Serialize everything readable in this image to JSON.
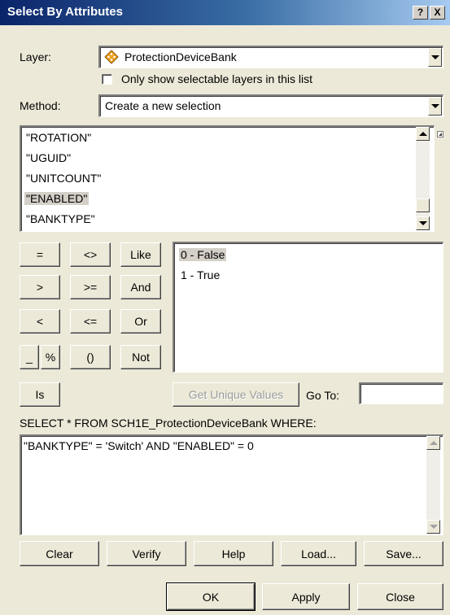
{
  "window": {
    "title": "Select By Attributes",
    "help_label": "?",
    "close_label": "X"
  },
  "layer": {
    "label": "Layer:",
    "value": "ProtectionDeviceBank",
    "icon": "layer-diamond-icon",
    "checkbox_label": "Only show selectable layers in this list",
    "checkbox_checked": false
  },
  "method": {
    "label": "Method:",
    "value": "Create a new selection"
  },
  "fields": {
    "items": [
      "\"ROTATION\"",
      "\"UGUID\"",
      "\"UNITCOUNT\"",
      "\"ENABLED\"",
      "\"BANKTYPE\""
    ],
    "selected_index": 3
  },
  "operators": {
    "row1": [
      "=",
      "<>",
      "Like"
    ],
    "row2": [
      ">",
      ">=",
      "And"
    ],
    "row3": [
      "<",
      "<=",
      "Or"
    ],
    "row4": [
      "_",
      "%",
      "()",
      "Not"
    ],
    "is_label": "Is"
  },
  "values": {
    "items": [
      "0 - False",
      "1 - True"
    ],
    "selected_index": 0,
    "unique_button": "Get Unique Values",
    "goto_label": "Go To:",
    "goto_value": ""
  },
  "sql": {
    "prefix": "SELECT * FROM SCH1E_ProtectionDeviceBank WHERE:",
    "expression": "\"BANKTYPE\" = 'Switch' AND \"ENABLED\" = 0"
  },
  "actions": {
    "clear": "Clear",
    "verify": "Verify",
    "help": "Help",
    "load": "Load...",
    "save": "Save..."
  },
  "dialog": {
    "ok": "OK",
    "apply": "Apply",
    "close": "Close"
  }
}
